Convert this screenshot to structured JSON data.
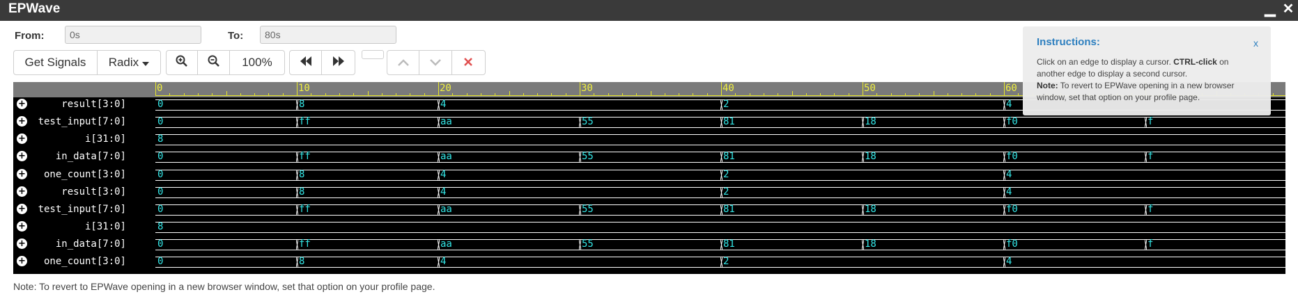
{
  "window": {
    "title": "EPWave",
    "minimize_glyph": "▁",
    "close_glyph": "✕"
  },
  "range": {
    "from_label": "From:",
    "from_value": "0s",
    "to_label": "To:",
    "to_value": "80s"
  },
  "toolbar": {
    "get_signals": "Get Signals",
    "radix": "Radix",
    "zoom_level": "100%"
  },
  "ruler": {
    "ticks": [
      "0",
      "10",
      "20",
      "30",
      "40",
      "50",
      "60"
    ]
  },
  "signals": [
    {
      "name": "result[3:0]",
      "values": [
        "0",
        "8",
        "4",
        "2",
        "4"
      ]
    },
    {
      "name": "test_input[7:0]",
      "values": [
        "0",
        "ff",
        "aa",
        "55",
        "81",
        "18",
        "f0",
        "f"
      ]
    },
    {
      "name": "i[31:0]",
      "values": [
        "8"
      ]
    },
    {
      "name": "in_data[7:0]",
      "values": [
        "0",
        "ff",
        "aa",
        "55",
        "81",
        "18",
        "f0",
        "f"
      ]
    },
    {
      "name": "one_count[3:0]",
      "values": [
        "0",
        "8",
        "4",
        "2",
        "4"
      ]
    },
    {
      "name": "result[3:0]",
      "values": [
        "0",
        "8",
        "4",
        "2",
        "4"
      ]
    },
    {
      "name": "test_input[7:0]",
      "values": [
        "0",
        "ff",
        "aa",
        "55",
        "81",
        "18",
        "f0",
        "f"
      ]
    },
    {
      "name": "i[31:0]",
      "values": [
        "8"
      ]
    },
    {
      "name": "in_data[7:0]",
      "values": [
        "0",
        "ff",
        "aa",
        "55",
        "81",
        "18",
        "f0",
        "f"
      ]
    },
    {
      "name": "one_count[3:0]",
      "values": [
        "0",
        "8",
        "4",
        "2",
        "4"
      ]
    }
  ],
  "instructions": {
    "title": "Instructions:",
    "close": "x",
    "line1_pre": "Click on an edge to display a cursor. ",
    "line1_bold": "CTRL-click",
    "line1_post": " on another edge to display a second cursor.",
    "note_bold": "Note:",
    "note_text": " To revert to EPWave opening in a new browser window, set that option on your profile page."
  },
  "footer": {
    "note": "Note: To revert to EPWave opening in a new browser window, set that option on your profile page."
  },
  "colors": {
    "titlebar": "#3a3a3a",
    "wave_bg": "#000000",
    "ruler": "#7a7a7a",
    "tick": "#e8e82a",
    "value": "#33e6e6",
    "accent": "#2d7fbf",
    "danger": "#e05050"
  }
}
